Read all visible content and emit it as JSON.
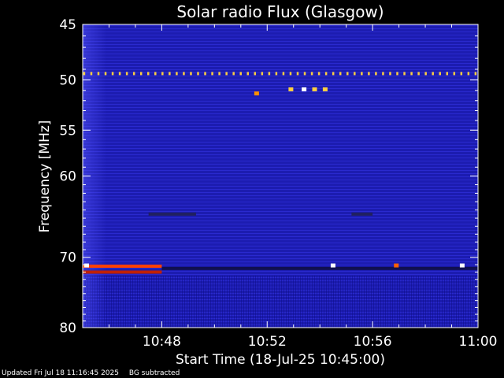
{
  "chart_data": {
    "type": "heatmap",
    "title": "Solar radio Flux (Glasgow)",
    "xlabel": "Start Time (18-Jul-25 10:45:00)",
    "ylabel": "Frequency [MHz]",
    "x_range_minutes": [
      0,
      15
    ],
    "x_ticks": [
      {
        "minute": 3,
        "label": "10:48"
      },
      {
        "minute": 7,
        "label": "10:52"
      },
      {
        "minute": 11,
        "label": "10:56"
      },
      {
        "minute": 15,
        "label": "11:00"
      }
    ],
    "y_range_mhz": [
      45,
      80
    ],
    "y_scale": "log",
    "y_ticks": [
      45,
      50,
      55,
      60,
      70,
      80
    ],
    "colors": {
      "background": "#1a1aa8",
      "low": "#0a0a7a",
      "mid": "#3030e0",
      "hot": "#ff3a00",
      "hotter": "#ffd000",
      "peak": "#ffffff"
    },
    "features": [
      {
        "type": "dotted_line",
        "freq_mhz": 49.4,
        "minute_start": 0,
        "minute_end": 15,
        "step_minutes": 0.27,
        "color": "#ffd040"
      },
      {
        "type": "band",
        "freq_mhz": 71.2,
        "minute_start": 0,
        "minute_end": 3,
        "color": "#ff4000"
      },
      {
        "type": "band",
        "freq_mhz": 72.0,
        "minute_start": 0,
        "minute_end": 3,
        "color": "#c02000"
      },
      {
        "type": "band",
        "freq_mhz": 64.5,
        "minute_start": 2.5,
        "minute_end": 4.3,
        "color": "#202060"
      },
      {
        "type": "band",
        "freq_mhz": 64.5,
        "minute_start": 10.2,
        "minute_end": 11.0,
        "color": "#202060"
      },
      {
        "type": "band",
        "freq_mhz": 71.5,
        "minute_start": 3,
        "minute_end": 15,
        "color": "#101050"
      },
      {
        "type": "spot",
        "freq_mhz": 50.9,
        "minute": 7.9,
        "color": "#ffd040"
      },
      {
        "type": "spot",
        "freq_mhz": 50.9,
        "minute": 8.4,
        "color": "#ffffff"
      },
      {
        "type": "spot",
        "freq_mhz": 50.9,
        "minute": 8.8,
        "color": "#ffd040"
      },
      {
        "type": "spot",
        "freq_mhz": 50.9,
        "minute": 9.2,
        "color": "#ffd040"
      },
      {
        "type": "spot",
        "freq_mhz": 51.3,
        "minute": 6.6,
        "color": "#ff9000"
      },
      {
        "type": "spot",
        "freq_mhz": 71.1,
        "minute": 9.5,
        "color": "#ffffff"
      },
      {
        "type": "spot",
        "freq_mhz": 71.1,
        "minute": 14.4,
        "color": "#ffffff"
      },
      {
        "type": "spot",
        "freq_mhz": 71.1,
        "minute": 0.15,
        "color": "#ffffff"
      },
      {
        "type": "spot",
        "freq_mhz": 71.1,
        "minute": 11.9,
        "color": "#ff6000"
      }
    ]
  },
  "footer": {
    "updated": "Updated Fri Jul 18 11:16:45 2025",
    "bg_note": "BG subtracted"
  }
}
